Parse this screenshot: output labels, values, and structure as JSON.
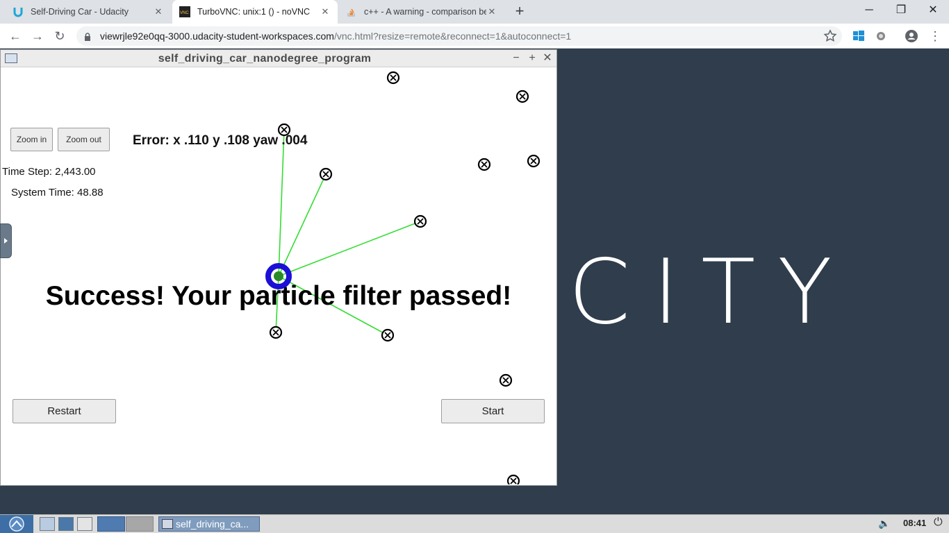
{
  "browser": {
    "tabs": [
      {
        "title": "Self-Driving Car - Udacity",
        "icon": "udacity-icon",
        "active": false
      },
      {
        "title": "TurboVNC: unix:1 () - noVNC",
        "icon": "vnc-icon",
        "active": true
      },
      {
        "title": "c++ - A warning - comparison be",
        "icon": "stackoverflow-icon",
        "active": false
      }
    ],
    "new_tab": "+",
    "url_host": "viewrjle92e0qq-3000.udacity-student-workspaces.com",
    "url_path": "/vnc.html?resize=remote&reconnect=1&autoconnect=1"
  },
  "vnc_window": {
    "title": "self_driving_car_nanodegree_program"
  },
  "simulator": {
    "zoom_in_label": "Zoom in",
    "zoom_out_label": "Zoom out",
    "error_text": "Error: x .110 y .108 yaw .004",
    "time_step": "Time Step: 2,443.00",
    "system_time": "System Time: 48.88",
    "success_text": "Success! Your particle filter passed!",
    "restart_label": "Restart",
    "start_label": "Start",
    "colors": {
      "observation_line": "#33dd33",
      "vehicle": "#1a10d6",
      "landmark": "#000000"
    }
  },
  "desktop": {
    "brand_text": "CITY"
  },
  "taskbar": {
    "window_label": "self_driving_ca...",
    "clock": "08:41"
  }
}
